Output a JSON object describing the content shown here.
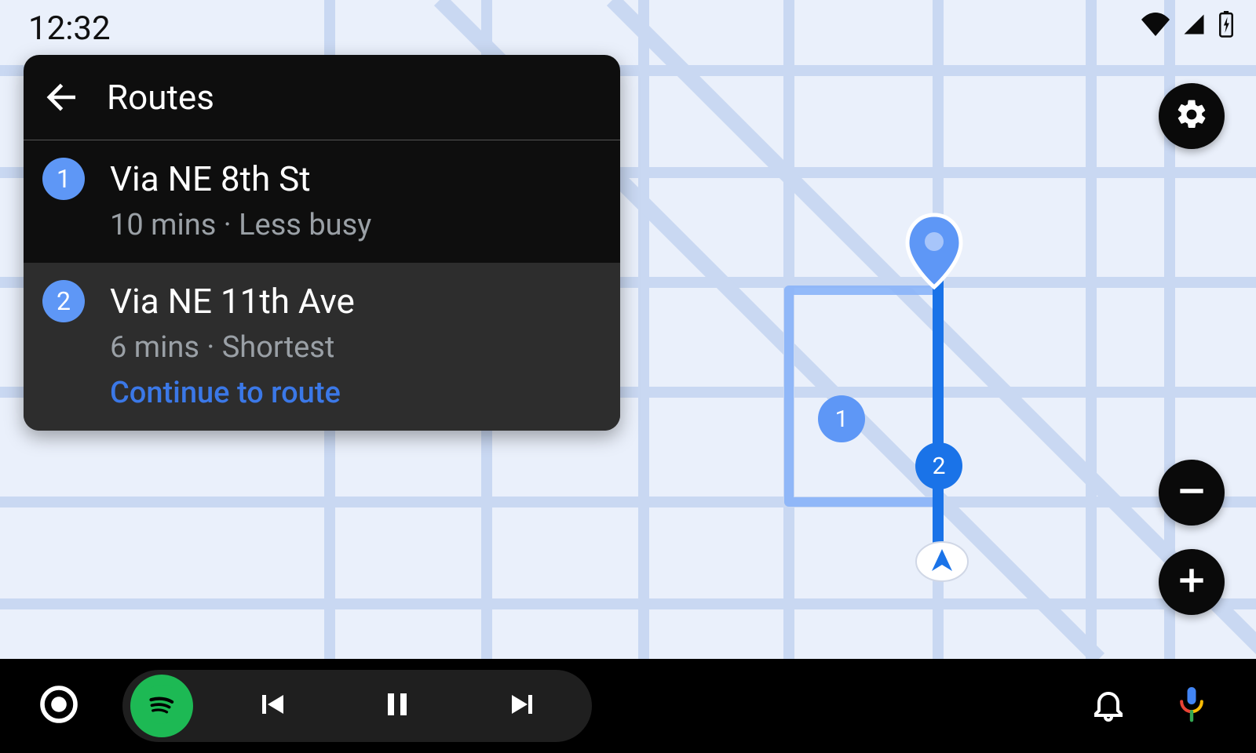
{
  "status": {
    "time": "12:32"
  },
  "panel": {
    "title": "Routes",
    "routes": [
      {
        "num": "1",
        "name": "Via NE 8th St",
        "sub": "10 mins · Less busy"
      },
      {
        "num": "2",
        "name": "Via NE 11th Ave",
        "sub": "6 mins · Shortest",
        "action": "Continue to route"
      }
    ]
  },
  "map_markers": {
    "one": "1",
    "two": "2"
  },
  "colors": {
    "accent": "#5E97F6",
    "accent_dark": "#1A73E8",
    "spotify": "#1DB954"
  }
}
